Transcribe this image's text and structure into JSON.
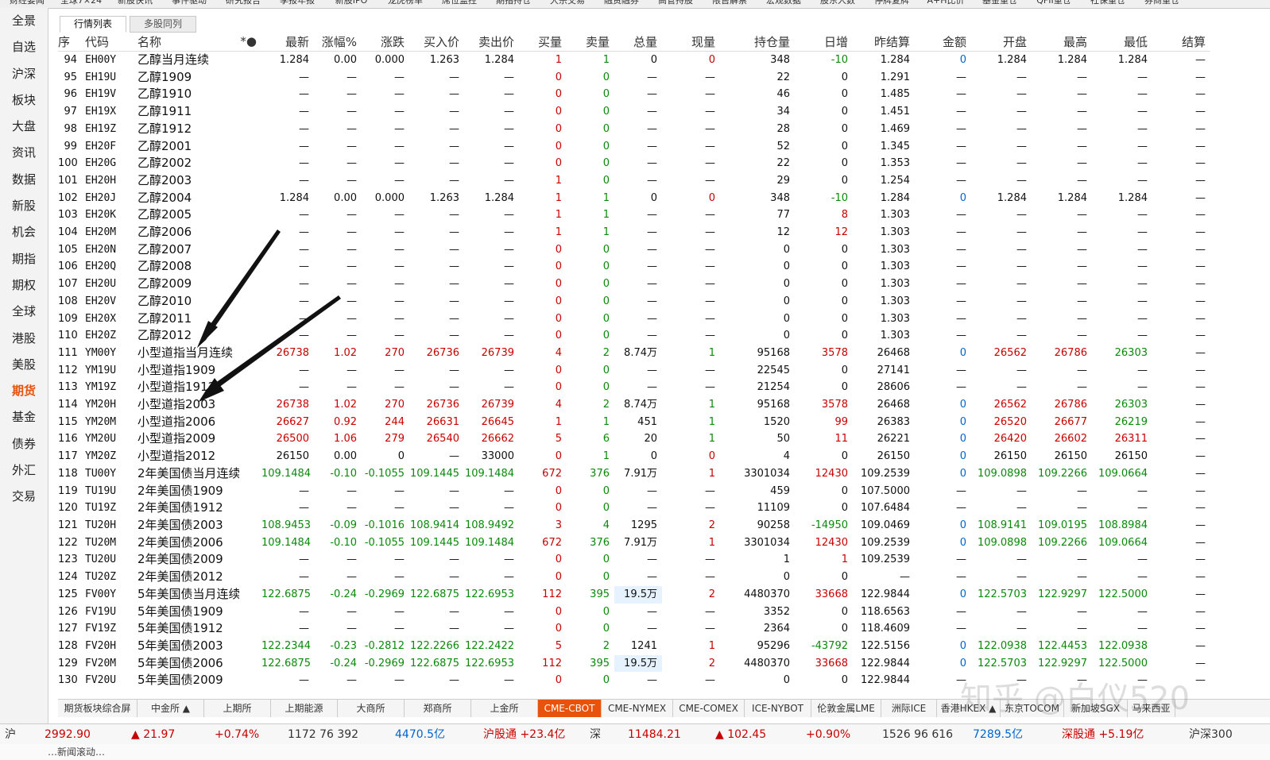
{
  "top_menu": [
    "财经要闻",
    "全球7×24",
    "新股快讯",
    "事件驱动",
    "研究报告",
    "季报年报",
    "新股IPO",
    "龙虎榜单",
    "席位监控",
    "期指持仓",
    "大宗交易",
    "融资融券",
    "高管持股",
    "限售解禁",
    "宏观数据",
    "股东人数",
    "停牌复牌",
    "A+H比价",
    "基金重仓",
    "QFII重仓",
    "社保重仓",
    "券商重仓"
  ],
  "sidebar": [
    "全景",
    "自选",
    "沪深",
    "板块",
    "大盘",
    "资讯",
    "数据",
    "新股",
    "机会",
    "期指",
    "期权",
    "全球",
    "港股",
    "美股",
    "期货",
    "基金",
    "债券",
    "外汇",
    "交易"
  ],
  "sidebar_active": 14,
  "tabs": [
    "行情列表",
    "多股同列"
  ],
  "columns": [
    "序",
    "代码",
    "名称",
    "*●",
    "最新",
    "涨幅%",
    "涨跌",
    "买入价",
    "卖出价",
    "买量",
    "卖量",
    "总量",
    "现量",
    "持仓量",
    "日增",
    "昨结算",
    "金额",
    "开盘",
    "最高",
    "最低",
    "结算"
  ],
  "rows": [
    [
      "94",
      "EH00Y",
      "乙醇当月连续",
      "",
      "1.284",
      "0.00",
      "0.000",
      "1.263",
      "1.284",
      "1",
      "1",
      "0",
      "0",
      "348",
      "-10",
      "1.284",
      "0",
      "1.284",
      "1.284",
      "1.284",
      "—"
    ],
    [
      "95",
      "EH19U",
      "乙醇1909",
      "",
      "—",
      "—",
      "—",
      "—",
      "—",
      "0",
      "0",
      "—",
      "—",
      "22",
      "0",
      "1.291",
      "—",
      "—",
      "—",
      "—",
      "—"
    ],
    [
      "96",
      "EH19V",
      "乙醇1910",
      "",
      "—",
      "—",
      "—",
      "—",
      "—",
      "0",
      "0",
      "—",
      "—",
      "46",
      "0",
      "1.485",
      "—",
      "—",
      "—",
      "—",
      "—"
    ],
    [
      "97",
      "EH19X",
      "乙醇1911",
      "",
      "—",
      "—",
      "—",
      "—",
      "—",
      "0",
      "0",
      "—",
      "—",
      "34",
      "0",
      "1.451",
      "—",
      "—",
      "—",
      "—",
      "—"
    ],
    [
      "98",
      "EH19Z",
      "乙醇1912",
      "",
      "—",
      "—",
      "—",
      "—",
      "—",
      "0",
      "0",
      "—",
      "—",
      "28",
      "0",
      "1.469",
      "—",
      "—",
      "—",
      "—",
      "—"
    ],
    [
      "99",
      "EH20F",
      "乙醇2001",
      "",
      "—",
      "—",
      "—",
      "—",
      "—",
      "0",
      "0",
      "—",
      "—",
      "52",
      "0",
      "1.345",
      "—",
      "—",
      "—",
      "—",
      "—"
    ],
    [
      "100",
      "EH20G",
      "乙醇2002",
      "",
      "—",
      "—",
      "—",
      "—",
      "—",
      "0",
      "0",
      "—",
      "—",
      "22",
      "0",
      "1.353",
      "—",
      "—",
      "—",
      "—",
      "—"
    ],
    [
      "101",
      "EH20H",
      "乙醇2003",
      "",
      "—",
      "—",
      "—",
      "—",
      "—",
      "1",
      "0",
      "—",
      "—",
      "29",
      "0",
      "1.254",
      "—",
      "—",
      "—",
      "—",
      "—"
    ],
    [
      "102",
      "EH20J",
      "乙醇2004",
      "",
      "1.284",
      "0.00",
      "0.000",
      "1.263",
      "1.284",
      "1",
      "1",
      "0",
      "0",
      "348",
      "-10",
      "1.284",
      "0",
      "1.284",
      "1.284",
      "1.284",
      "—"
    ],
    [
      "103",
      "EH20K",
      "乙醇2005",
      "",
      "—",
      "—",
      "—",
      "—",
      "—",
      "1",
      "1",
      "—",
      "—",
      "77",
      "8",
      "1.303",
      "—",
      "—",
      "—",
      "—",
      "—"
    ],
    [
      "104",
      "EH20M",
      "乙醇2006",
      "",
      "—",
      "—",
      "—",
      "—",
      "—",
      "1",
      "1",
      "—",
      "—",
      "12",
      "12",
      "1.303",
      "—",
      "—",
      "—",
      "—",
      "—"
    ],
    [
      "105",
      "EH20N",
      "乙醇2007",
      "",
      "—",
      "—",
      "—",
      "—",
      "—",
      "0",
      "0",
      "—",
      "—",
      "0",
      "0",
      "1.303",
      "—",
      "—",
      "—",
      "—",
      "—"
    ],
    [
      "106",
      "EH20Q",
      "乙醇2008",
      "",
      "—",
      "—",
      "—",
      "—",
      "—",
      "0",
      "0",
      "—",
      "—",
      "0",
      "0",
      "1.303",
      "—",
      "—",
      "—",
      "—",
      "—"
    ],
    [
      "107",
      "EH20U",
      "乙醇2009",
      "",
      "—",
      "—",
      "—",
      "—",
      "—",
      "0",
      "0",
      "—",
      "—",
      "0",
      "0",
      "1.303",
      "—",
      "—",
      "—",
      "—",
      "—"
    ],
    [
      "108",
      "EH20V",
      "乙醇2010",
      "",
      "—",
      "—",
      "—",
      "—",
      "—",
      "0",
      "0",
      "—",
      "—",
      "0",
      "0",
      "1.303",
      "—",
      "—",
      "—",
      "—",
      "—"
    ],
    [
      "109",
      "EH20X",
      "乙醇2011",
      "",
      "—",
      "—",
      "—",
      "—",
      "—",
      "0",
      "0",
      "—",
      "—",
      "0",
      "0",
      "1.303",
      "—",
      "—",
      "—",
      "—",
      "—"
    ],
    [
      "110",
      "EH20Z",
      "乙醇2012",
      "",
      "—",
      "—",
      "—",
      "—",
      "—",
      "0",
      "0",
      "—",
      "—",
      "0",
      "0",
      "1.303",
      "—",
      "—",
      "—",
      "—",
      "—"
    ],
    [
      "111",
      "YM00Y",
      "小型道指当月连续",
      "",
      "26738",
      "1.02",
      "270",
      "26736",
      "26739",
      "4",
      "2",
      "8.74万",
      "1",
      "95168",
      "3578",
      "26468",
      "0",
      "26562",
      "26786",
      "26303",
      "—"
    ],
    [
      "112",
      "YM19U",
      "小型道指1909",
      "",
      "—",
      "—",
      "—",
      "—",
      "—",
      "0",
      "0",
      "—",
      "—",
      "22545",
      "0",
      "27141",
      "—",
      "—",
      "—",
      "—",
      "—"
    ],
    [
      "113",
      "YM19Z",
      "小型道指1912",
      "",
      "—",
      "—",
      "—",
      "—",
      "—",
      "0",
      "0",
      "—",
      "—",
      "21254",
      "0",
      "28606",
      "—",
      "—",
      "—",
      "—",
      "—"
    ],
    [
      "114",
      "YM20H",
      "小型道指2003",
      "",
      "26738",
      "1.02",
      "270",
      "26736",
      "26739",
      "4",
      "2",
      "8.74万",
      "1",
      "95168",
      "3578",
      "26468",
      "0",
      "26562",
      "26786",
      "26303",
      "—"
    ],
    [
      "115",
      "YM20M",
      "小型道指2006",
      "",
      "26627",
      "0.92",
      "244",
      "26631",
      "26645",
      "1",
      "1",
      "451",
      "1",
      "1520",
      "99",
      "26383",
      "0",
      "26520",
      "26677",
      "26219",
      "—"
    ],
    [
      "116",
      "YM20U",
      "小型道指2009",
      "",
      "26500",
      "1.06",
      "279",
      "26540",
      "26662",
      "5",
      "6",
      "20",
      "1",
      "50",
      "11",
      "26221",
      "0",
      "26420",
      "26602",
      "26311",
      "—"
    ],
    [
      "117",
      "YM20Z",
      "小型道指2012",
      "",
      "26150",
      "0.00",
      "0",
      "—",
      "33000",
      "0",
      "1",
      "0",
      "0",
      "4",
      "0",
      "26150",
      "0",
      "26150",
      "26150",
      "26150",
      "—"
    ],
    [
      "118",
      "TU00Y",
      "2年美国债当月连续",
      "",
      "109.1484",
      "-0.10",
      "-0.1055",
      "109.1445",
      "109.1484",
      "672",
      "376",
      "7.91万",
      "1",
      "3301034",
      "12430",
      "109.2539",
      "0",
      "109.0898",
      "109.2266",
      "109.0664",
      "—"
    ],
    [
      "119",
      "TU19U",
      "2年美国债1909",
      "",
      "—",
      "—",
      "—",
      "—",
      "—",
      "0",
      "0",
      "—",
      "—",
      "459",
      "0",
      "107.5000",
      "—",
      "—",
      "—",
      "—",
      "—"
    ],
    [
      "120",
      "TU19Z",
      "2年美国债1912",
      "",
      "—",
      "—",
      "—",
      "—",
      "—",
      "0",
      "0",
      "—",
      "—",
      "11109",
      "0",
      "107.6484",
      "—",
      "—",
      "—",
      "—",
      "—"
    ],
    [
      "121",
      "TU20H",
      "2年美国债2003",
      "",
      "108.9453",
      "-0.09",
      "-0.1016",
      "108.9414",
      "108.9492",
      "3",
      "4",
      "1295",
      "2",
      "90258",
      "-14950",
      "109.0469",
      "0",
      "108.9141",
      "109.0195",
      "108.8984",
      "—"
    ],
    [
      "122",
      "TU20M",
      "2年美国债2006",
      "",
      "109.1484",
      "-0.10",
      "-0.1055",
      "109.1445",
      "109.1484",
      "672",
      "376",
      "7.91万",
      "1",
      "3301034",
      "12430",
      "109.2539",
      "0",
      "109.0898",
      "109.2266",
      "109.0664",
      "—"
    ],
    [
      "123",
      "TU20U",
      "2年美国债2009",
      "",
      "—",
      "—",
      "—",
      "—",
      "—",
      "0",
      "0",
      "—",
      "—",
      "1",
      "1",
      "109.2539",
      "—",
      "—",
      "—",
      "—",
      "—"
    ],
    [
      "124",
      "TU20Z",
      "2年美国债2012",
      "",
      "—",
      "—",
      "—",
      "—",
      "—",
      "0",
      "0",
      "—",
      "—",
      "0",
      "0",
      "—",
      "—",
      "—",
      "—",
      "—",
      "—"
    ],
    [
      "125",
      "FV00Y",
      "5年美国债当月连续",
      "",
      "122.6875",
      "-0.24",
      "-0.2969",
      "122.6875",
      "122.6953",
      "112",
      "395",
      "19.5万",
      "2",
      "4480370",
      "33668",
      "122.9844",
      "0",
      "122.5703",
      "122.9297",
      "122.5000",
      "—"
    ],
    [
      "126",
      "FV19U",
      "5年美国债1909",
      "",
      "—",
      "—",
      "—",
      "—",
      "—",
      "0",
      "0",
      "—",
      "—",
      "3352",
      "0",
      "118.6563",
      "—",
      "—",
      "—",
      "—",
      "—"
    ],
    [
      "127",
      "FV19Z",
      "5年美国债1912",
      "",
      "—",
      "—",
      "—",
      "—",
      "—",
      "0",
      "0",
      "—",
      "—",
      "2364",
      "0",
      "118.4609",
      "—",
      "—",
      "—",
      "—",
      "—"
    ],
    [
      "128",
      "FV20H",
      "5年美国债2003",
      "",
      "122.2344",
      "-0.23",
      "-0.2812",
      "122.2266",
      "122.2422",
      "5",
      "2",
      "1241",
      "1",
      "95296",
      "-43792",
      "122.5156",
      "0",
      "122.0938",
      "122.4453",
      "122.0938",
      "—"
    ],
    [
      "129",
      "FV20M",
      "5年美国债2006",
      "",
      "122.6875",
      "-0.24",
      "-0.2969",
      "122.6875",
      "122.6953",
      "112",
      "395",
      "19.5万",
      "2",
      "4480370",
      "33668",
      "122.9844",
      "0",
      "122.5703",
      "122.9297",
      "122.5000",
      "—"
    ],
    [
      "130",
      "FV20U",
      "5年美国债2009",
      "",
      "—",
      "—",
      "—",
      "—",
      "—",
      "0",
      "0",
      "—",
      "—",
      "0",
      "0",
      "122.9844",
      "—",
      "—",
      "—",
      "—",
      "—"
    ]
  ],
  "bottom_tabs": [
    "期货板块综合屏",
    "中金所 ▲",
    "上期所",
    "上期能源",
    "大商所",
    "郑商所",
    "上金所",
    "CME-CBOT",
    "CME-NYMEX",
    "CME-COMEX",
    "ICE-NYBOT",
    "伦敦金属LME",
    "洲际ICE",
    "香港HKEX ▲",
    "东京TOCOM",
    "新加坡SGX",
    "马来西亚"
  ],
  "bottom_tab_active": 7,
  "status": {
    "sh_label": "沪",
    "sh_index": "2992.90",
    "sh_change": "▲ 21.97",
    "sh_pct": "+0.74%",
    "sh_counts": "1172 76 392",
    "sh_amount": "4470.5亿",
    "hgt": "沪股通 +23.4亿",
    "sz_label": "深",
    "sz_index": "11484.21",
    "sz_change": "▲ 102.45",
    "sz_pct": "+0.90%",
    "sz_counts": "1526 96 616",
    "sz_amount": "7289.5亿",
    "sgt": "深股通 +5.19亿",
    "hs300": "沪深300"
  },
  "ticker_text": "…新闻滚动…",
  "watermark": "知乎 @白仪520",
  "colors": {
    "up": "#c80000",
    "down": "#0a8a0a",
    "neutral": "#111111",
    "blue": "#0066cc",
    "accent": "#e8520a"
  }
}
